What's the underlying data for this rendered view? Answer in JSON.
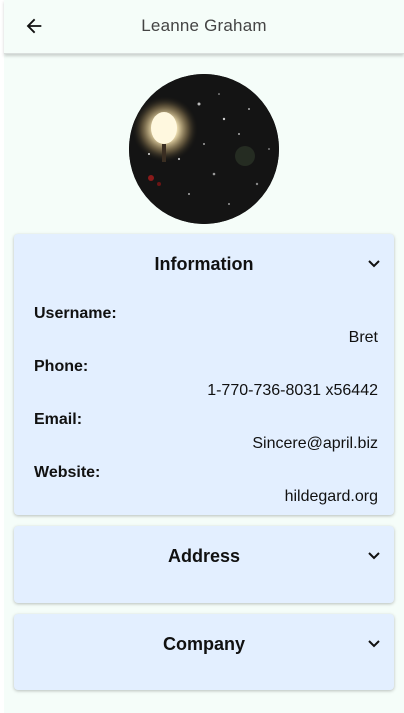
{
  "header": {
    "title": "Leanne Graham",
    "back_icon": "arrow-left-icon"
  },
  "avatar": {
    "alt": "street-lamp-photo"
  },
  "colors": {
    "app_background": "#f5fdf9",
    "card_background": "#e3efff",
    "text": "#111111"
  },
  "sections": {
    "information": {
      "title": "Information",
      "expanded": true,
      "fields": {
        "username": {
          "label": "Username:",
          "value": "Bret"
        },
        "phone": {
          "label": "Phone:",
          "value": "1-770-736-8031 x56442"
        },
        "email": {
          "label": "Email:",
          "value": "Sincere@april.biz"
        },
        "website": {
          "label": "Website:",
          "value": "hildegard.org"
        }
      }
    },
    "address": {
      "title": "Address",
      "expanded": false
    },
    "company": {
      "title": "Company",
      "expanded": false
    }
  }
}
